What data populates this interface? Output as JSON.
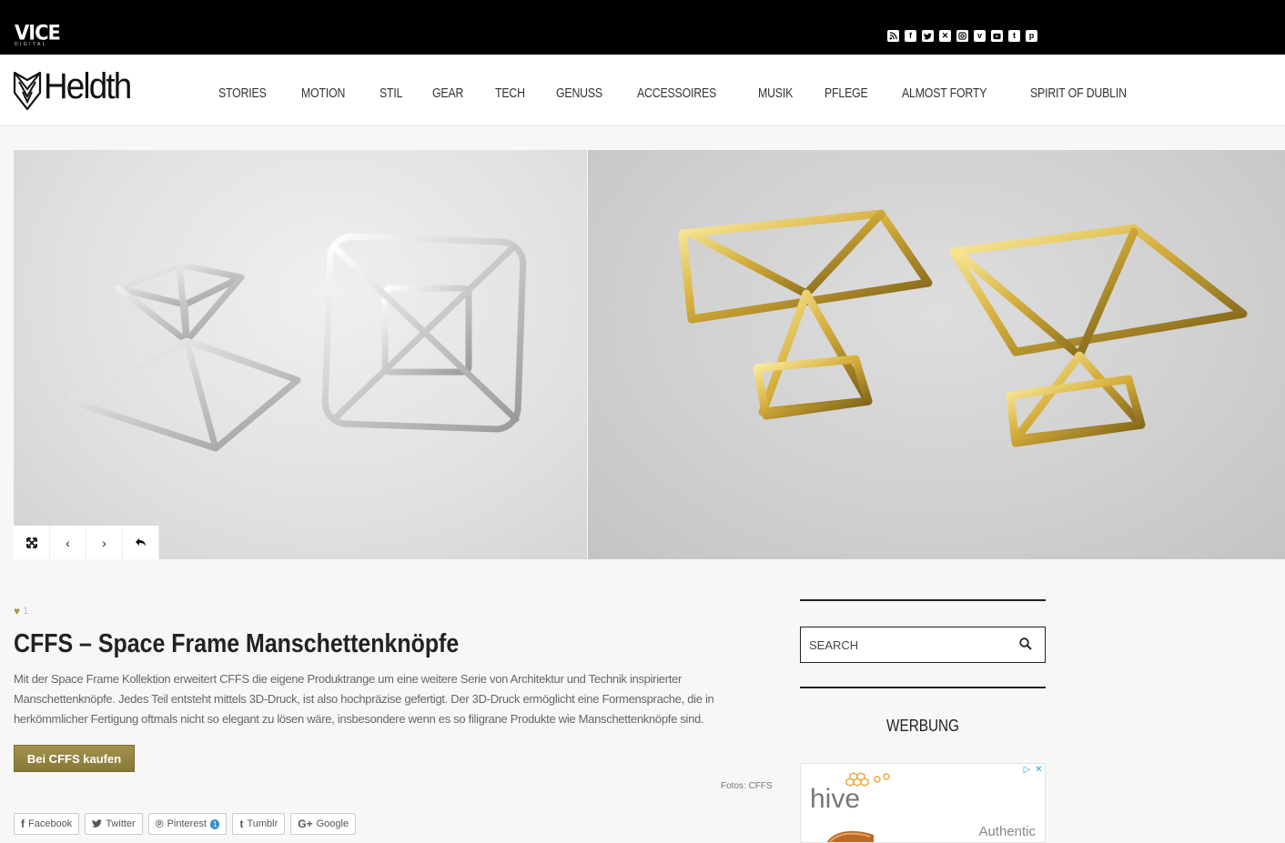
{
  "topbar": {
    "logo_main": "VICE",
    "logo_sub": "DIGITAL",
    "social_icons": [
      "rss-icon",
      "facebook-icon",
      "twitter-icon",
      "xing-icon",
      "instagram-icon",
      "vimeo-icon",
      "youtube-icon",
      "tumblr-icon",
      "pinterest-icon"
    ]
  },
  "nav": {
    "brand": "Heldth",
    "items": [
      "STORIES",
      "MOTION",
      "STIL",
      "GEAR",
      "TECH",
      "GENUSS",
      "ACCESSOIRES",
      "MUSIK",
      "PFLEGE",
      "ALMOST FORTY",
      "SPIRIT OF DUBLIN"
    ]
  },
  "gallery": {
    "controls": [
      "expand-icon",
      "prev-icon",
      "next-icon",
      "back-icon"
    ]
  },
  "article": {
    "likes": "1",
    "title": "CFFS – Space Frame Manschettenknöpfe",
    "body": "Mit der Space Frame Kollektion erweitert CFFS die eigene Produktrange um eine weitere Serie von Architektur und Technik inspirierter Manschettenknöpfe. Jedes Teil entsteht mittels 3D-Druck, ist also hochpräzise gefertigt. Der 3D-Druck ermöglicht eine Formensprache, die in herkömmlicher Fertigung oftmals nicht so elegant zu lösen wäre, insbesondere wenn es so filigrane Produkte wie Manschettenknöpfe sind.",
    "buy_label": "Bei CFFS kaufen",
    "credit": "Fotos: CFFS",
    "share": {
      "facebook": "Facebook",
      "twitter": "Twitter",
      "pinterest": "Pinterest",
      "pinterest_count": "1",
      "tumblr": "Tumblr",
      "google": "Google"
    }
  },
  "sidebar": {
    "search_placeholder": "SEARCH",
    "ad_heading": "WERBUNG",
    "ad": {
      "brand": "hive",
      "tagline": "Authentic"
    }
  },
  "colors": {
    "accent_gold": "#a3924e",
    "topbar_bg": "#000000",
    "share_count": "#3b8fc9"
  }
}
